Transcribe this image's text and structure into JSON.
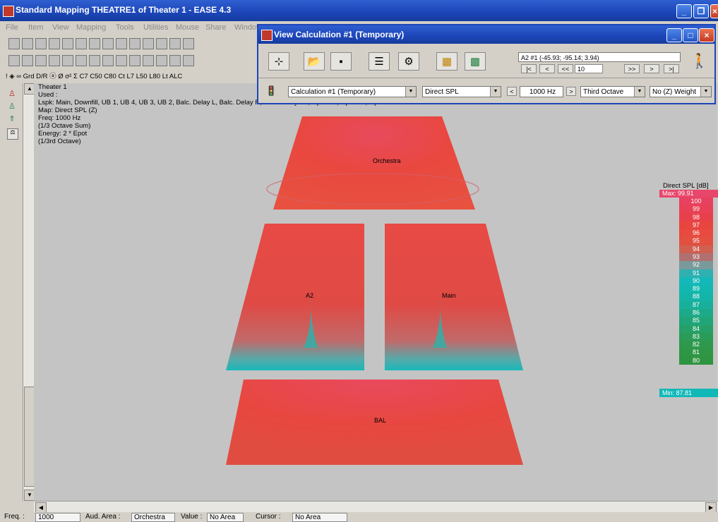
{
  "window": {
    "title": "Standard Mapping THEATRE1 of Theater 1 - EASE 4.3"
  },
  "menu": [
    "File",
    "Item",
    "View",
    "Mapping",
    "Tools",
    "Utilities",
    "Mouse",
    "Share",
    "Window"
  ],
  "toolbar_text": "! ◈ ∞ Grd D/R ⓐ Ø σ² Σ C7 C50 C80 Ct L7 L50 L80 Lt ALC",
  "info": {
    "lines": [
      "Theater 1",
      "Used :",
      "Lspk: Main, Downfill, UB 1, UB 4, UB 3, UB 2, Balc. Delay L, Balc. Delay R, Balc. Delay Ctr, Lip Fill 2, Lip Fill 3, Lip Fill 1",
      "Map: Direct SPL (Z)",
      "Freq: 1000 Hz",
      "(1/3 Octave Sum)",
      "Energy: 2 * Epot",
      "(1/3rd Octave)"
    ]
  },
  "areas": {
    "orchestra": "Orchestra",
    "a2": "A2",
    "main": "Main",
    "bal": "BAL"
  },
  "legend": {
    "title": "Direct SPL [dB]",
    "max": "Max: 99.91",
    "min": "Min: 87.81",
    "ticks": [
      "100",
      "99",
      "98",
      "97",
      "96",
      "95",
      "94",
      "93",
      "92",
      "91",
      "90",
      "89",
      "88",
      "87",
      "86",
      "85",
      "84",
      "83",
      "82",
      "81",
      "80"
    ],
    "colors": [
      "#e84060",
      "#e84055",
      "#e8404a",
      "#e84540",
      "#e84a3f",
      "#e25040",
      "#cf6050",
      "#b07070",
      "#7a9a9a",
      "#30b0b0",
      "#15b8b8",
      "#12b8b0",
      "#14b4a8",
      "#18b09a",
      "#1caa8a",
      "#20a578",
      "#26a068",
      "#2a9c58",
      "#2e984c",
      "#2e9644",
      "#2f9440"
    ]
  },
  "dialog": {
    "title": "View Calculation #1 (Temporary)",
    "position": "A2 #1  (-45.93; -95.14; 3.94)",
    "nav": {
      "first": "|<",
      "prev": "<",
      "fast_prev": "<<",
      "step": "10",
      "fast_next": ">>",
      "next": ">",
      "last": ">|"
    },
    "calc_select": "Calculation #1 (Temporary)",
    "map_select": "Direct SPL",
    "freq": "1000 Hz",
    "bandwidth": "Third Octave",
    "weight": "No (Z) Weight",
    "freq_prev": "<",
    "freq_next": ">"
  },
  "status": {
    "freq_label": "Freq. :",
    "freq_value": "1000",
    "area_label": "Aud. Area :",
    "area_value": "Orchestra",
    "value_label": "Value :",
    "value_value": "No Area",
    "cursor_label": "Cursor :",
    "cursor_value": "No Area"
  },
  "colors": {
    "titlebar": "#1c45b8",
    "map_red": "#e84a40",
    "map_cyan": "#15b8b8",
    "canvas": "#c4c4c4"
  }
}
